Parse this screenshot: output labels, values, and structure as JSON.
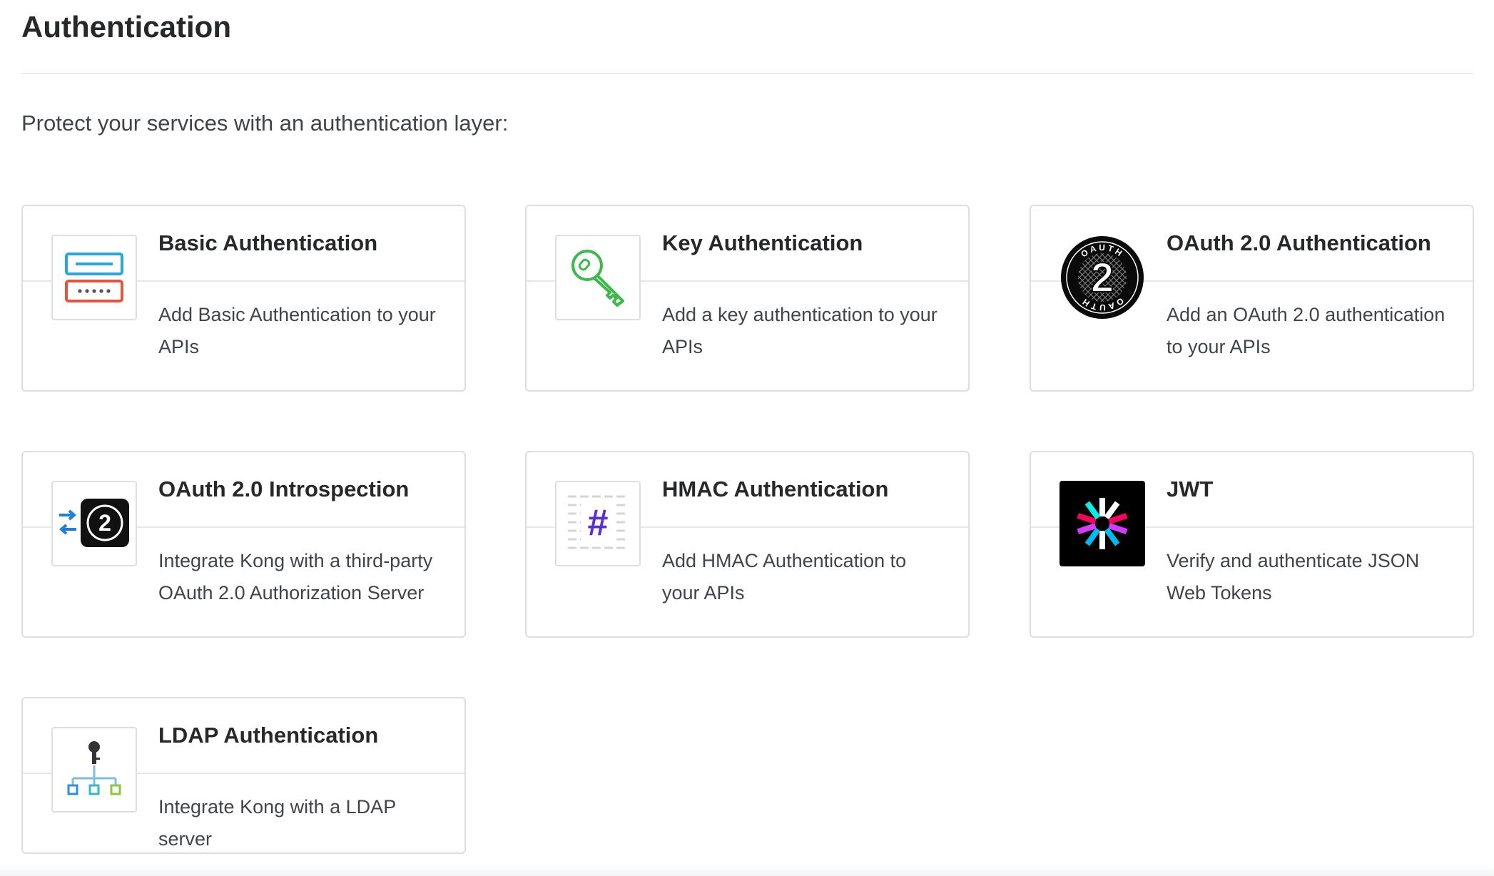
{
  "header": {
    "title": "Authentication",
    "intro": "Protect your services with an authentication layer:"
  },
  "plugins": [
    {
      "title": "Basic Authentication",
      "description": "Add Basic Authentication to your APIs",
      "icon": "basic-auth-icon"
    },
    {
      "title": "Key Authentication",
      "description": "Add a key authentication to your APIs",
      "icon": "key-icon"
    },
    {
      "title": "OAuth 2.0 Authentication",
      "description": "Add an OAuth 2.0 authentication to your APIs",
      "icon": "oauth2-logo-icon",
      "icon_text": "OAUTH"
    },
    {
      "title": "OAuth 2.0 Introspection",
      "description": "Integrate Kong with a third-party OAuth 2.0 Authorization Server",
      "icon": "oauth2-introspection-icon"
    },
    {
      "title": "HMAC Authentication",
      "description": "Add HMAC Authentication to your APIs",
      "icon": "hmac-hash-icon"
    },
    {
      "title": "JWT",
      "description": "Verify and authenticate JSON Web Tokens",
      "icon": "jwt-logo-icon"
    },
    {
      "title": "LDAP Authentication",
      "description": "Integrate Kong with a LDAP server",
      "icon": "ldap-tree-icon"
    }
  ],
  "colors": {
    "basic_blue": "#29a5e0",
    "basic_red": "#e8533f",
    "key_green": "#3cb94b",
    "hmac_purple": "#5a2fd6",
    "introspection_blue": "#1f7fd6",
    "jwt_bg": "#000000",
    "ldap_blue": "#2f8fdc",
    "ldap_green": "#8cc63f"
  }
}
